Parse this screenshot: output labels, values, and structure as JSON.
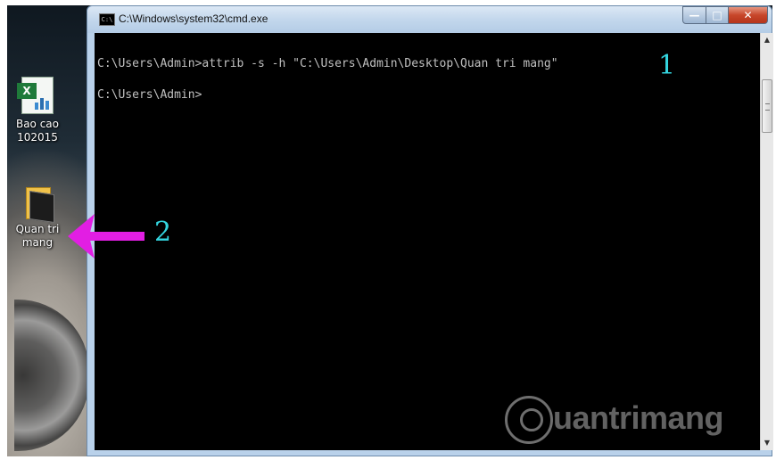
{
  "desktop": {
    "icons": [
      {
        "label_line1": "Bao cao",
        "label_line2": "102015",
        "icon": "excel-file-icon"
      },
      {
        "label_line1": "Quan tri",
        "label_line2": "mang",
        "icon": "folder-icon"
      }
    ]
  },
  "window": {
    "title": "C:\\Windows\\system32\\cmd.exe",
    "app_icon_text": "C:\\",
    "controls": {
      "minimize": "—",
      "maximize": "□",
      "close": "✕"
    }
  },
  "console": {
    "lines": [
      "C:\\Users\\Admin>attrib -s -h \"C:\\Users\\Admin\\Desktop\\Quan tri mang\"",
      "C:\\Users\\Admin>"
    ]
  },
  "annotations": {
    "step1": "1",
    "step2": "2",
    "arrow_color": "#e21ee3",
    "number_color": "#34d6e0"
  },
  "watermark": {
    "text": "uantrimang"
  }
}
